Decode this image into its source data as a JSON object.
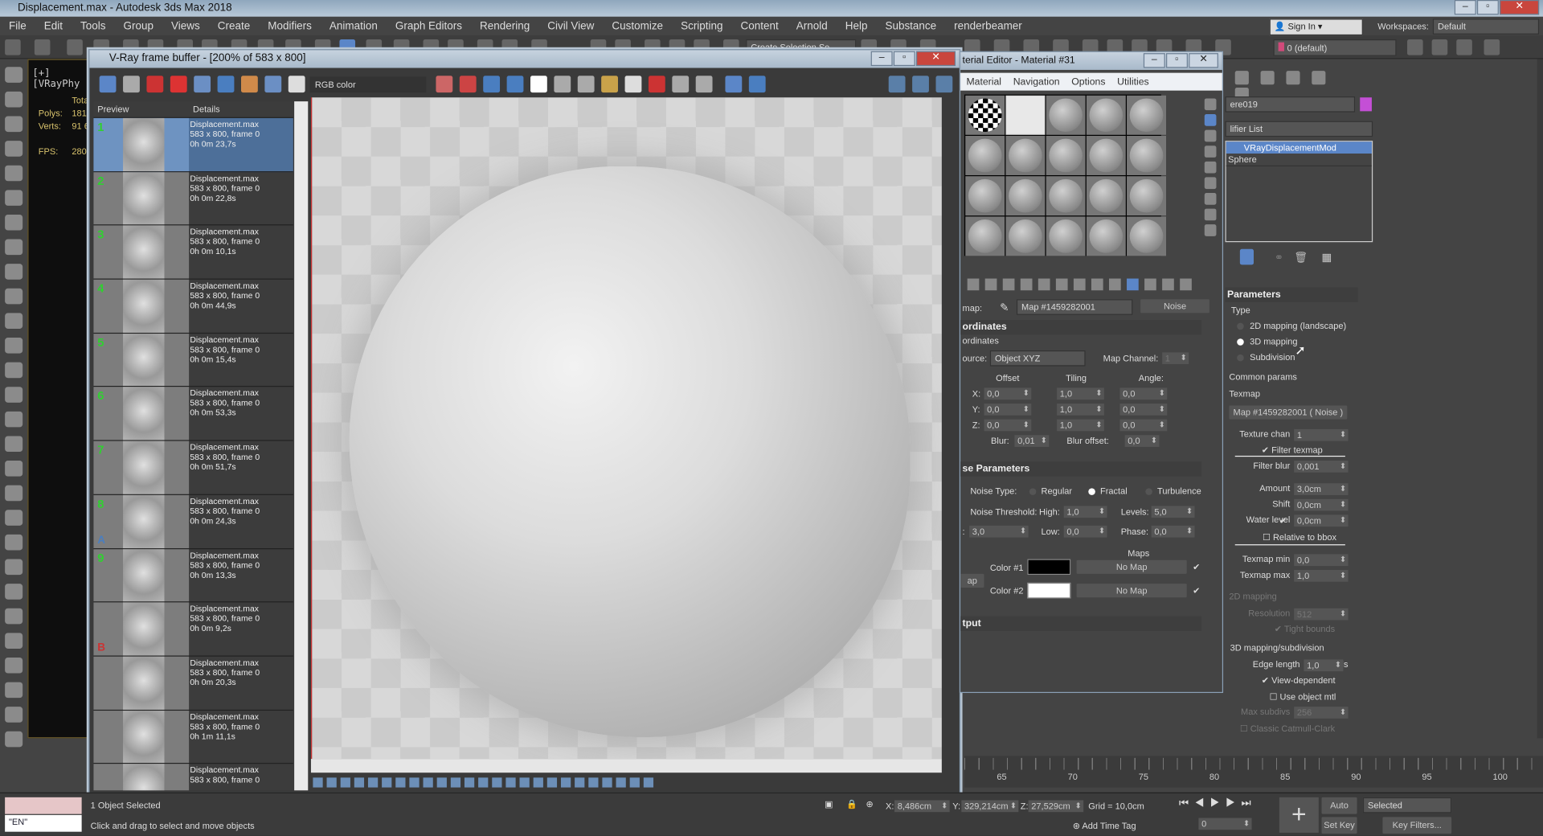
{
  "app": {
    "title": "Displacement.max - Autodesk 3ds Max 2018"
  },
  "menu": [
    "File",
    "Edit",
    "Tools",
    "Group",
    "Views",
    "Create",
    "Modifiers",
    "Animation",
    "Graph Editors",
    "Rendering",
    "Civil View",
    "Customize",
    "Scripting",
    "Content",
    "Arnold",
    "Help",
    "Substance",
    "renderbeamer"
  ],
  "top_right": {
    "sign_in": "Sign In",
    "workspaces_label": "Workspaces:",
    "workspace": "Default",
    "layer": "0 (default)",
    "selection_set": "Create Selection Se"
  },
  "viewport": {
    "label": "[+][VRayPhy",
    "total": "Tota",
    "polys_label": "Polys:",
    "polys": "181",
    "verts_label": "Verts:",
    "verts": "91 6",
    "fps_label": "FPS:",
    "fps": "280"
  },
  "vfb": {
    "title": "V-Ray frame buffer - [200% of 583 x 800]",
    "channel": "RGB color",
    "col_preview": "Preview",
    "col_details": "Details",
    "history": [
      {
        "n": "1",
        "file": "Displacement.max",
        "res": "583 x 800, frame 0",
        "time": "0h 0m 23,7s"
      },
      {
        "n": "2",
        "file": "Displacement.max",
        "res": "583 x 800, frame 0",
        "time": "0h 0m 22,8s"
      },
      {
        "n": "3",
        "file": "Displacement.max",
        "res": "583 x 800, frame 0",
        "time": "0h 0m 10,1s"
      },
      {
        "n": "4",
        "file": "Displacement.max",
        "res": "583 x 800, frame 0",
        "time": "0h 0m 44,9s"
      },
      {
        "n": "5",
        "file": "Displacement.max",
        "res": "583 x 800, frame 0",
        "time": "0h 0m 15,4s"
      },
      {
        "n": "6",
        "file": "Displacement.max",
        "res": "583 x 800, frame 0",
        "time": "0h 0m 53,3s"
      },
      {
        "n": "7",
        "file": "Displacement.max",
        "res": "583 x 800, frame 0",
        "time": "0h 0m 51,7s"
      },
      {
        "n": "8",
        "file": "Displacement.max",
        "res": "583 x 800, frame 0",
        "time": "0h 0m 24,3s",
        "ab": "A"
      },
      {
        "n": "9",
        "file": "Displacement.max",
        "res": "583 x 800, frame 0",
        "time": "0h 0m 13,3s"
      },
      {
        "n": "",
        "file": "Displacement.max",
        "res": "583 x 800, frame 0",
        "time": "0h 0m 9,2s",
        "ab": "B"
      },
      {
        "n": "",
        "file": "Displacement.max",
        "res": "583 x 800, frame 0",
        "time": "0h 0m 20,3s"
      },
      {
        "n": "",
        "file": "Displacement.max",
        "res": "583 x 800, frame 0",
        "time": "0h 1m 11,1s"
      },
      {
        "n": "",
        "file": "Displacement.max",
        "res": "583 x 800, frame 0",
        "time": ""
      }
    ]
  },
  "material_editor": {
    "title": "terial Editor - Material #31",
    "menu": [
      "Material",
      "Navigation",
      "Options",
      "Utilities"
    ],
    "map_label": "map:",
    "map_name": "Map #1459282001",
    "map_type": "Noise",
    "coords": {
      "header": "ordinates",
      "sub": "ordinates",
      "source_label": "ource:",
      "source": "Object XYZ",
      "map_channel_label": "Map Channel:",
      "map_channel": "1",
      "offset": "Offset",
      "tiling": "Tiling",
      "angle": "Angle:",
      "x": "X:",
      "y": "Y:",
      "z": "Z:",
      "offset_vals": [
        "0,0",
        "0,0",
        "0,0"
      ],
      "tiling_vals": [
        "1,0",
        "1,0",
        "1,0"
      ],
      "angle_vals": [
        "0,0",
        "0,0",
        "0,0"
      ],
      "blur_label": "Blur:",
      "blur": "0,01",
      "blur_offset_label": "Blur offset:",
      "blur_offset": "0,0"
    },
    "noise": {
      "header": "se Parameters",
      "type_label": "Noise Type:",
      "types": [
        "Regular",
        "Fractal",
        "Turbulence"
      ],
      "selected": "Fractal",
      "threshold_label": "Noise Threshold:",
      "high_label": "High:",
      "high": "1,0",
      "levels_label": "Levels:",
      "levels": "5,0",
      "size_label": ":",
      "size": "3,0",
      "low_label": "Low:",
      "low": "0,0",
      "phase_label": "Phase:",
      "phase": "0,0",
      "maps_label": "Maps",
      "color1_label": "Color #1",
      "color1": "#000000",
      "color2_label": "Color #2",
      "color2": "#ffffff",
      "no_map": "No Map",
      "swap": "ap"
    },
    "output_header": "tput"
  },
  "command_panel": {
    "object_name": "ere019",
    "object_color": "#c44fd6",
    "modifier_list": "lifier List",
    "stack": [
      "VRayDisplacementMod",
      "Sphere"
    ],
    "params_header": "Parameters",
    "type_label": "Type",
    "types": [
      "2D mapping (landscape)",
      "3D mapping",
      "Subdivision"
    ],
    "selected_type": "3D mapping",
    "common": "Common params",
    "texmap_label": "Texmap",
    "texmap": "Map #1459282001  ( Noise )",
    "texture_chan_label": "Texture chan",
    "texture_chan": "1",
    "filter_texmap": "Filter texmap",
    "filter_blur_label": "Filter blur",
    "filter_blur": "0,001",
    "amount_label": "Amount",
    "amount": "3,0cm",
    "shift_label": "Shift",
    "shift": "0,0cm",
    "water_label": "Water level",
    "water": "0,0cm",
    "relative": "Relative to bbox",
    "tmin_label": "Texmap min",
    "tmin": "0,0",
    "tmax_label": "Texmap max",
    "tmax": "1,0",
    "map2d": "2D mapping",
    "res_label": "Resolution",
    "res": "512",
    "tight": "Tight bounds",
    "map3d": "3D mapping/subdivision",
    "edge_label": "Edge length",
    "edge": "1,0",
    "pixels": "pixels",
    "view_dep": "View-dependent",
    "use_obj": "Use object mtl",
    "max_sub_label": "Max subdivs",
    "max_sub": "256",
    "catmull": "Classic Catmull-Clark"
  },
  "timeline": {
    "ticks": [
      "65",
      "70",
      "75",
      "80",
      "85",
      "90",
      "95",
      "100"
    ]
  },
  "status": {
    "selected": "1 Object Selected",
    "prompt": "Click and drag to select and move objects",
    "lang": "\"EN\"",
    "x_label": "X:",
    "x": "8,486cm",
    "y_label": "Y:",
    "y": "329,214cm",
    "z_label": "Z:",
    "z": "27,529cm",
    "grid": "Grid = 10,0cm",
    "add_time_tag": "Add Time Tag",
    "frame": "0",
    "auto_key": "Auto Key",
    "key_mode": "Selected",
    "set_key": "Set Key",
    "key_filters": "Key Filters..."
  }
}
